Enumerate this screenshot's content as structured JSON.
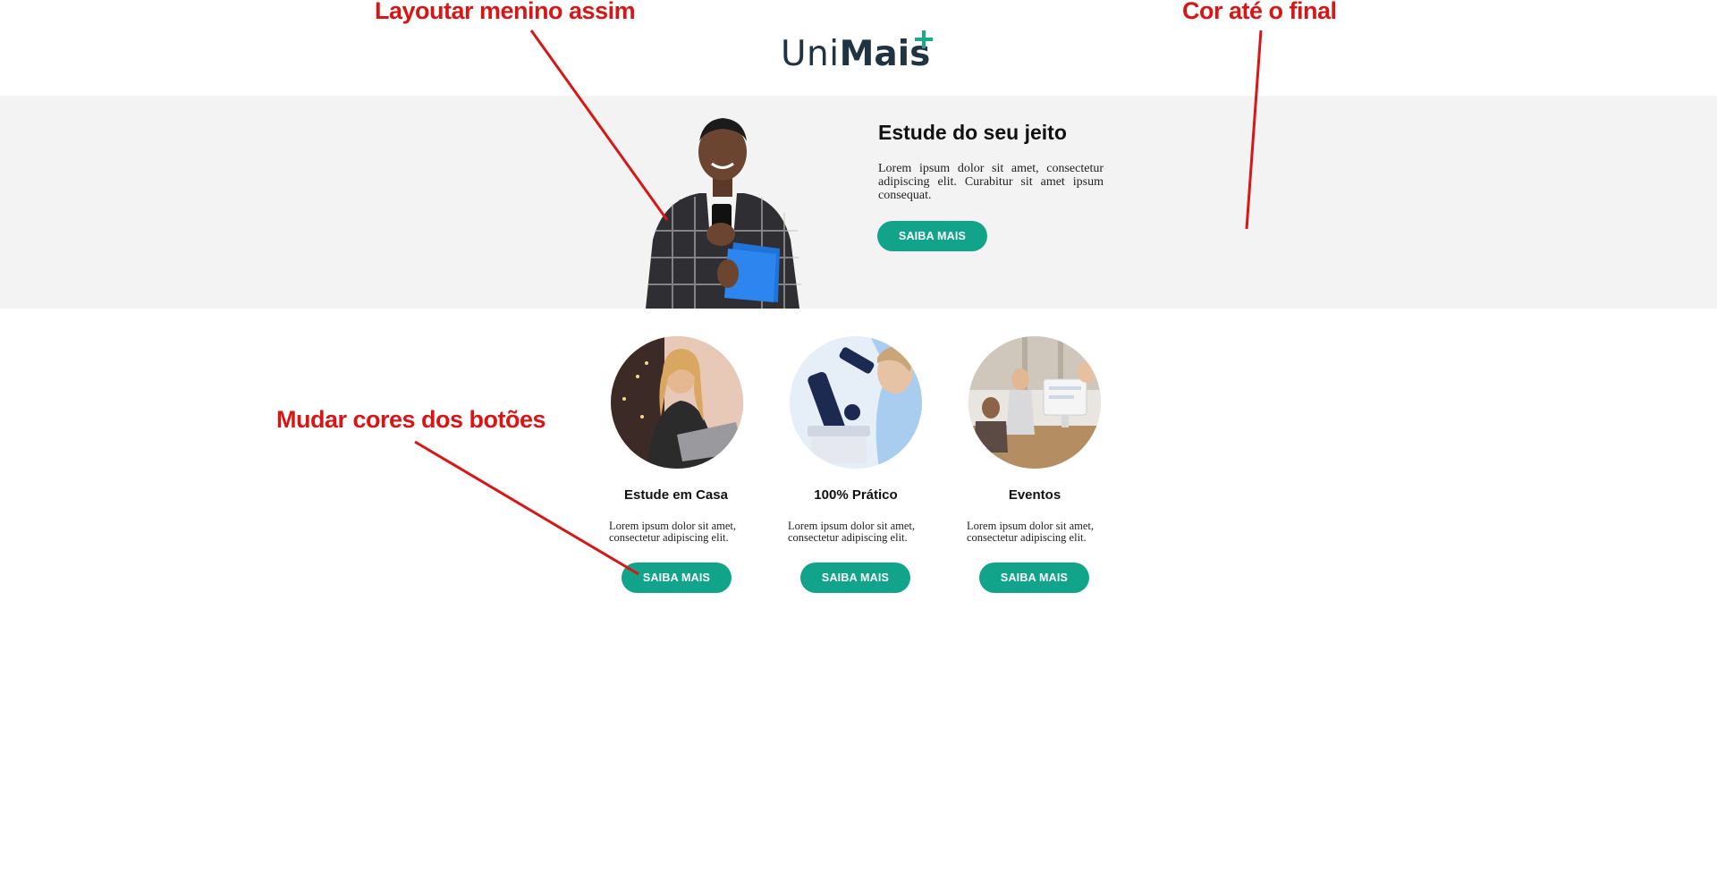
{
  "header": {
    "logo": {
      "uni": "Uni",
      "mais": "Mais"
    }
  },
  "hero": {
    "title": "Estude do seu jeito",
    "text": "Lorem ipsum dolor sit amet, consectetur adipiscing elit. Curabitur sit amet ipsum consequat.",
    "button_label": "SAIBA MAIS",
    "image": "student-boy-with-phone-and-folder"
  },
  "cards": [
    {
      "title": "Estude em Casa",
      "text": "Lorem ipsum dolor sit amet, consectetur adipiscing elit.",
      "button_label": "SAIBA MAIS",
      "image": "woman-studying-on-laptop"
    },
    {
      "title": "100% Prático",
      "text": "Lorem ipsum dolor sit amet, consectetur adipiscing elit.",
      "button_label": "SAIBA MAIS",
      "image": "scientist-with-microscope"
    },
    {
      "title": "Eventos",
      "text": "Lorem ipsum dolor sit amet, consectetur adipiscing elit.",
      "button_label": "SAIBA MAIS",
      "image": "office-meeting"
    }
  ],
  "annotations": [
    {
      "text": "Layoutar menino  assim"
    },
    {
      "text": "Cor até  o  final"
    },
    {
      "text": "Mudar cores dos botões"
    }
  ],
  "colors": {
    "accent": "#12a48a",
    "banner_bg": "#f3f3f3",
    "annotation": "#d81616",
    "logo_text": "#1f3342"
  }
}
